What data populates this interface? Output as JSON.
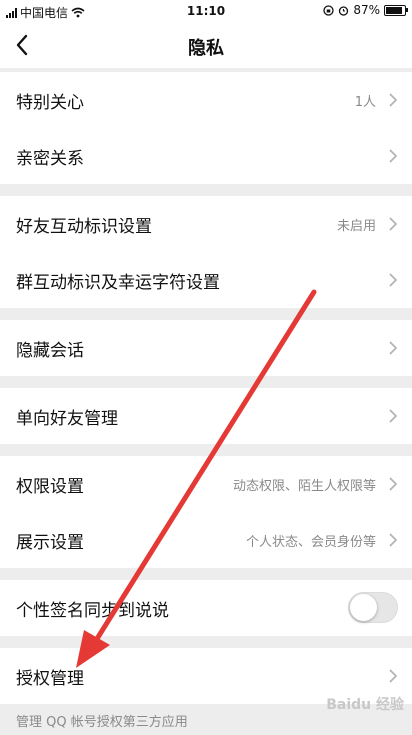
{
  "status_bar": {
    "carrier": "中国电信",
    "time": "11:10",
    "battery": "87%",
    "battery_level": 0.87
  },
  "header": {
    "title": "隐私"
  },
  "sections": [
    {
      "rows": [
        {
          "label": "特别关心",
          "value": "1人"
        },
        {
          "label": "亲密关系",
          "value": ""
        }
      ]
    },
    {
      "rows": [
        {
          "label": "好友互动标识设置",
          "value": "未启用"
        },
        {
          "label": "群互动标识及幸运字符设置",
          "value": ""
        }
      ]
    },
    {
      "rows": [
        {
          "label": "隐藏会话",
          "value": ""
        }
      ]
    },
    {
      "rows": [
        {
          "label": "单向好友管理",
          "value": ""
        }
      ]
    },
    {
      "rows": [
        {
          "label": "权限设置",
          "value": "动态权限、陌生人权限等"
        },
        {
          "label": "展示设置",
          "value": "个人状态、会员身份等"
        }
      ]
    },
    {
      "rows": [
        {
          "label": "个性签名同步到说说",
          "toggle_on": false
        }
      ]
    },
    {
      "rows": [
        {
          "label": "授权管理",
          "value": ""
        }
      ]
    }
  ],
  "footnote": "管理 QQ 帐号授权第三方应用",
  "watermark": "Baidu 经验",
  "annotation_arrow_color": "#e53935"
}
